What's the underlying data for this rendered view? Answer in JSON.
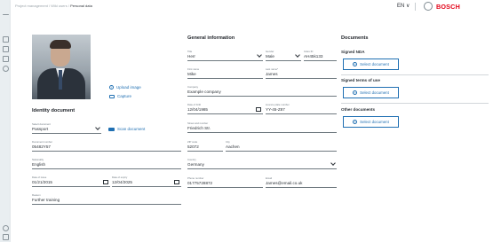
{
  "breadcrumb": {
    "part1": "Project management",
    "sep1": "/",
    "part2": "Wiki users",
    "sep2": "/",
    "current": "Personal data"
  },
  "header": {
    "language": "EN ∨",
    "brand": "BOSCH"
  },
  "photo_actions": {
    "upload": "Upload image",
    "capture": "Capture"
  },
  "identity": {
    "title": "Identity document",
    "select_document_label": "Select document",
    "select_document_value": "Passport",
    "scan_button": "Scan document",
    "document_number_label": "Document number",
    "document_number_value": "05482Y57",
    "nationality_label": "Nationality",
    "nationality_value": "English",
    "date_of_issue_label": "Date of issue",
    "date_of_issue_value": "01/21/2015",
    "date_of_expiry_label": "Date of expiry",
    "date_of_expiry_value": "12/04/2025",
    "reason_label": "Reason",
    "reason_value": "Further training"
  },
  "general": {
    "title": "General information",
    "title_label": "Title",
    "title_value": "Herr",
    "gender_label": "Gender",
    "gender_value": "Male",
    "index_label": "Index ID",
    "index_value": "AH45k133",
    "first_name_label": "First name",
    "first_name_value": "Mike",
    "last_name_label": "Last name*",
    "last_name_value": "James",
    "company_label": "Company",
    "company_value": "Example company",
    "dob_label": "Date of birth",
    "dob_value": "12/04/1985",
    "license_label": "Licence plate number",
    "license_value": "YY-45-Z87",
    "street_label": "Street and number",
    "street_value": "Friedrich Str.",
    "zip_label": "ZIP code",
    "zip_value": "52072",
    "city_label": "City",
    "city_value": "Aachen",
    "country_label": "Country",
    "country_value": "Germany",
    "phone_label": "Phone number",
    "phone_value": "01775728872",
    "email_label": "Email",
    "email_value": "James@email.co.uk"
  },
  "documents": {
    "title": "Documents",
    "nda_label": "Signed NDA",
    "terms_label": "Signed terms of use",
    "other_label": "Other documents",
    "select_button": "Select document"
  },
  "colors": {
    "accent": "#1f6fb2",
    "brand": "#e20015",
    "background": "#d6e4e9"
  }
}
